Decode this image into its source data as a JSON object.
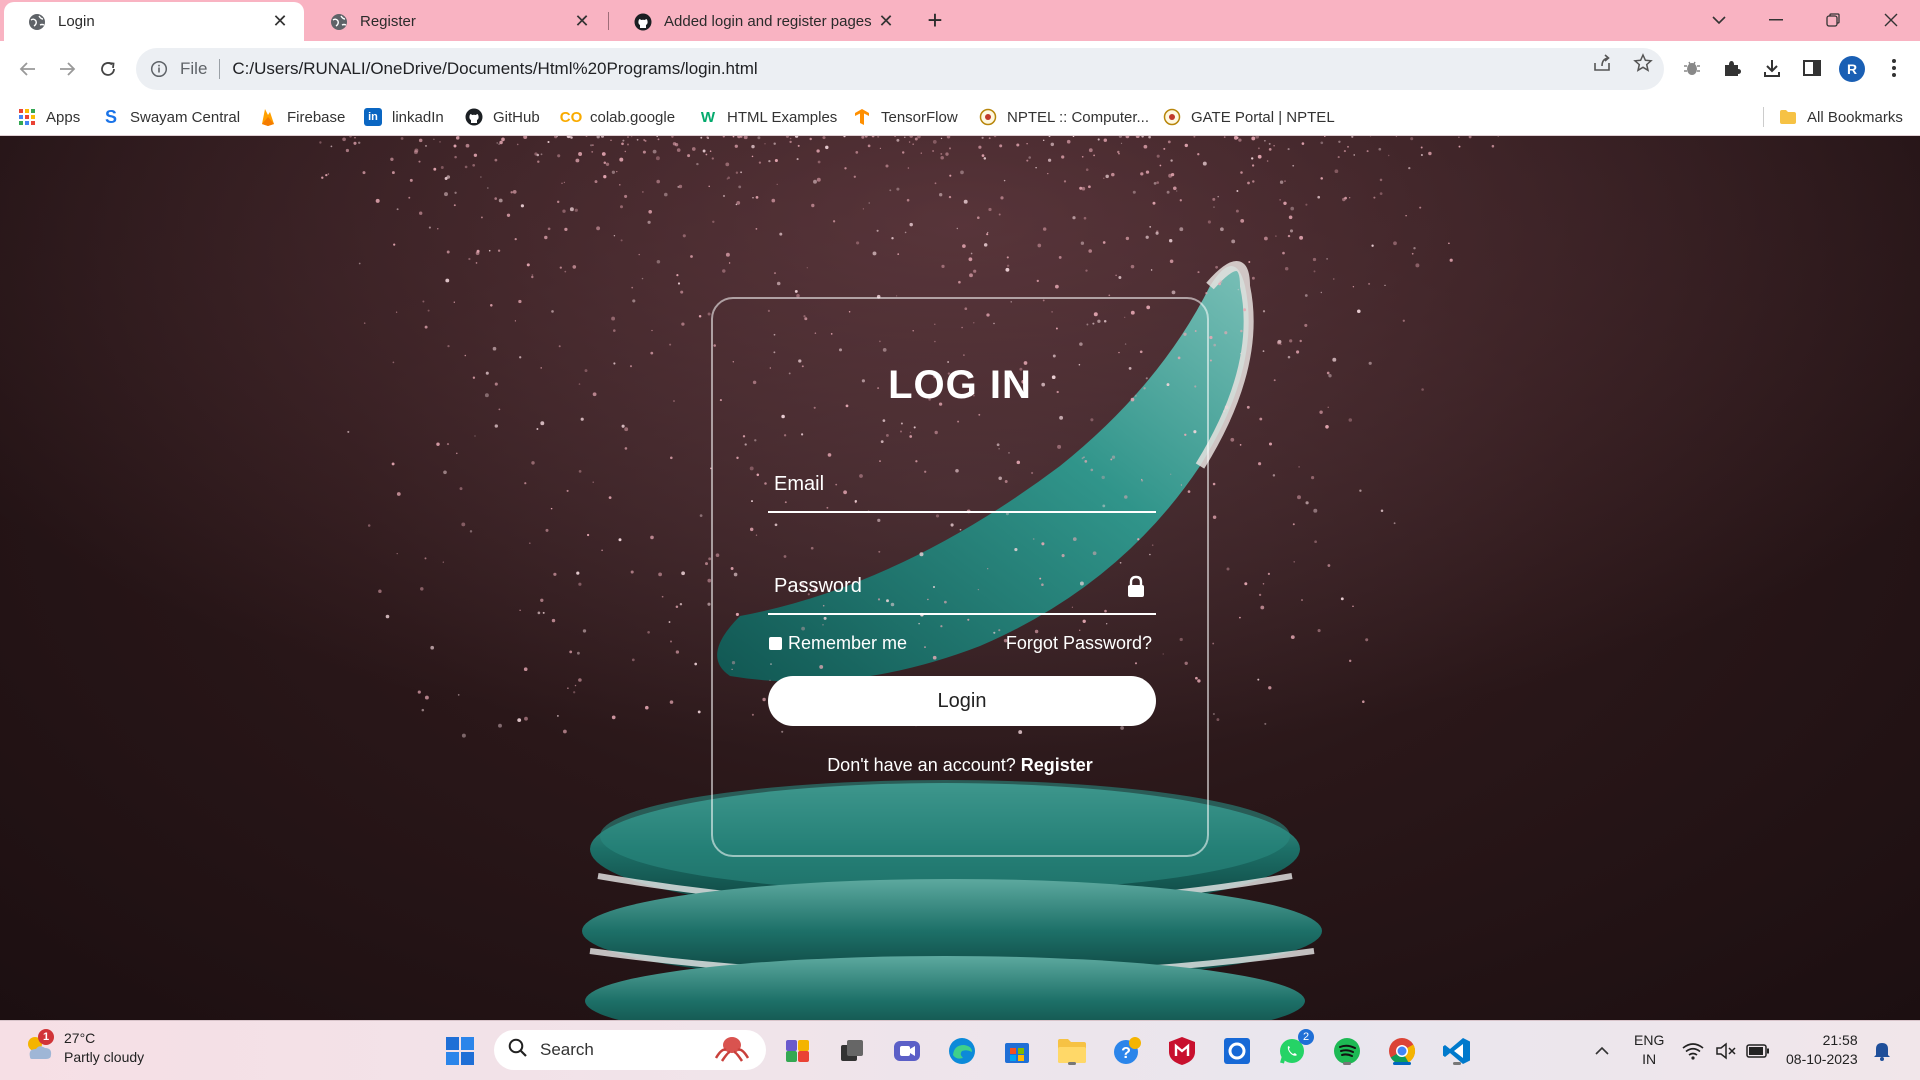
{
  "browser": {
    "tabs": [
      {
        "title": "Login",
        "active": true,
        "icon": "globe-icon"
      },
      {
        "title": "Register",
        "active": false,
        "icon": "globe-icon"
      },
      {
        "title": "Added login and register pages",
        "active": false,
        "icon": "github-icon"
      }
    ],
    "address": {
      "scheme": "File",
      "url": "C:/Users/RUNALI/OneDrive/Documents/Html%20Programs/login.html"
    },
    "profile_initial": "R",
    "bookmarks": [
      {
        "label": "Apps",
        "icon": "apps-grid-icon"
      },
      {
        "label": "Swayam Central",
        "icon": "swayam-icon"
      },
      {
        "label": "Firebase",
        "icon": "firebase-icon"
      },
      {
        "label": "linkadIn",
        "icon": "linkedin-icon"
      },
      {
        "label": "GitHub",
        "icon": "github-icon"
      },
      {
        "label": "colab.google",
        "icon": "colab-icon"
      },
      {
        "label": "HTML Examples",
        "icon": "w3schools-icon"
      },
      {
        "label": "TensorFlow",
        "icon": "tensorflow-icon"
      },
      {
        "label": "NPTEL :: Computer...",
        "icon": "nptel-icon"
      },
      {
        "label": "GATE Portal | NPTEL",
        "icon": "nptel-icon"
      }
    ],
    "all_bookmarks": "All Bookmarks"
  },
  "login": {
    "title": "LOG IN",
    "email_placeholder": "Email",
    "password_placeholder": "Password",
    "remember_label": "Remember me",
    "forgot_label": "Forgot Password?",
    "button_label": "Login",
    "no_account_text": "Don't have an account?",
    "register_link": "Register"
  },
  "taskbar": {
    "weather_temp": "27°C",
    "weather_desc": "Partly cloudy",
    "weather_badge": "1",
    "search_label": "Search",
    "whatsapp_badge": "2",
    "lang_top": "ENG",
    "lang_bottom": "IN",
    "time": "21:58",
    "date": "08-10-2023"
  },
  "colors": {
    "tabstrip": "#f9b3c2",
    "card_border": "#ffffff",
    "accent": "#0067c0"
  }
}
